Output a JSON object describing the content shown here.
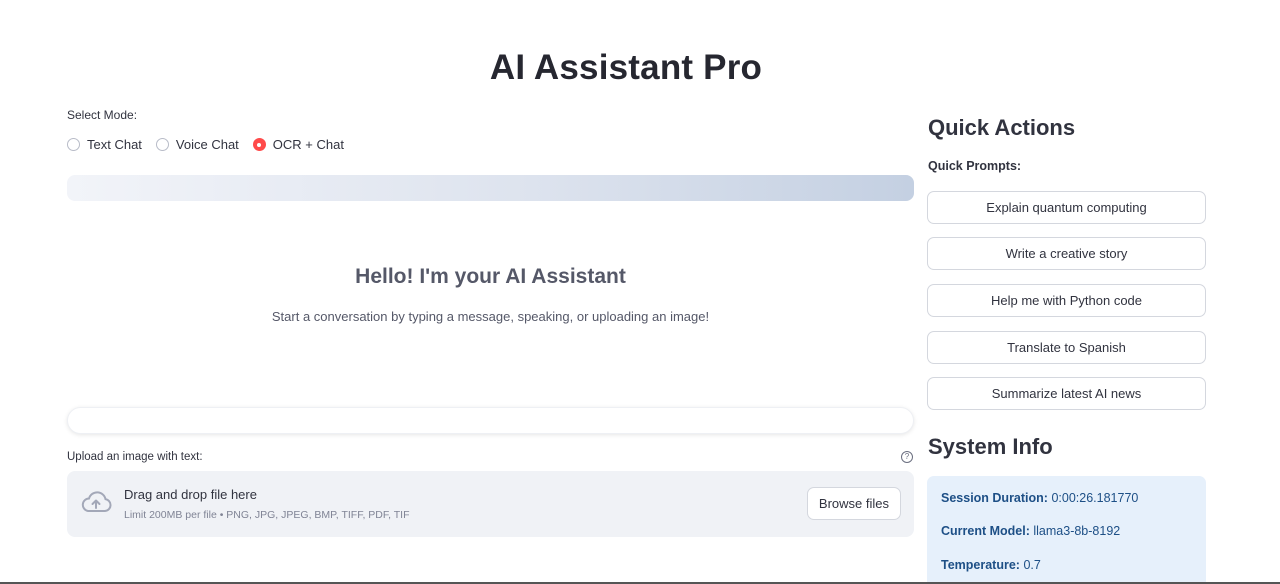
{
  "app": {
    "title": "AI Assistant Pro"
  },
  "mode": {
    "label": "Select Mode:",
    "options": [
      "Text Chat",
      "Voice Chat",
      "OCR + Chat"
    ],
    "selected": "OCR + Chat"
  },
  "welcome": {
    "title": "Hello! I'm your AI Assistant",
    "subtitle": "Start a conversation by typing a message, speaking, or uploading an image!"
  },
  "upload": {
    "label": "Upload an image with text:",
    "help_icon": "question-circle-icon",
    "drop_text": "Drag and drop file here",
    "limits": "Limit 200MB per file • PNG, JPG, JPEG, BMP, TIFF, PDF, TIF",
    "browse_label": "Browse files",
    "icon": "cloud-upload-icon"
  },
  "sidebar": {
    "quick_actions_title": "Quick Actions",
    "quick_prompts_label": "Quick Prompts:",
    "prompts": [
      "Explain quantum computing",
      "Write a creative story",
      "Help me with Python code",
      "Translate to Spanish",
      "Summarize latest AI news"
    ],
    "system_info_title": "System Info",
    "system_info": {
      "session_label": "Session Duration:",
      "session_value": "0:00:26.181770",
      "model_label": "Current Model:",
      "model_value": "llama3-8b-8192",
      "temp_label": "Temperature:",
      "temp_value": "0.7"
    }
  },
  "colors": {
    "accent": "#ff4b4b",
    "info_bg": "#e6f0fb",
    "info_text": "#1d4f86"
  }
}
